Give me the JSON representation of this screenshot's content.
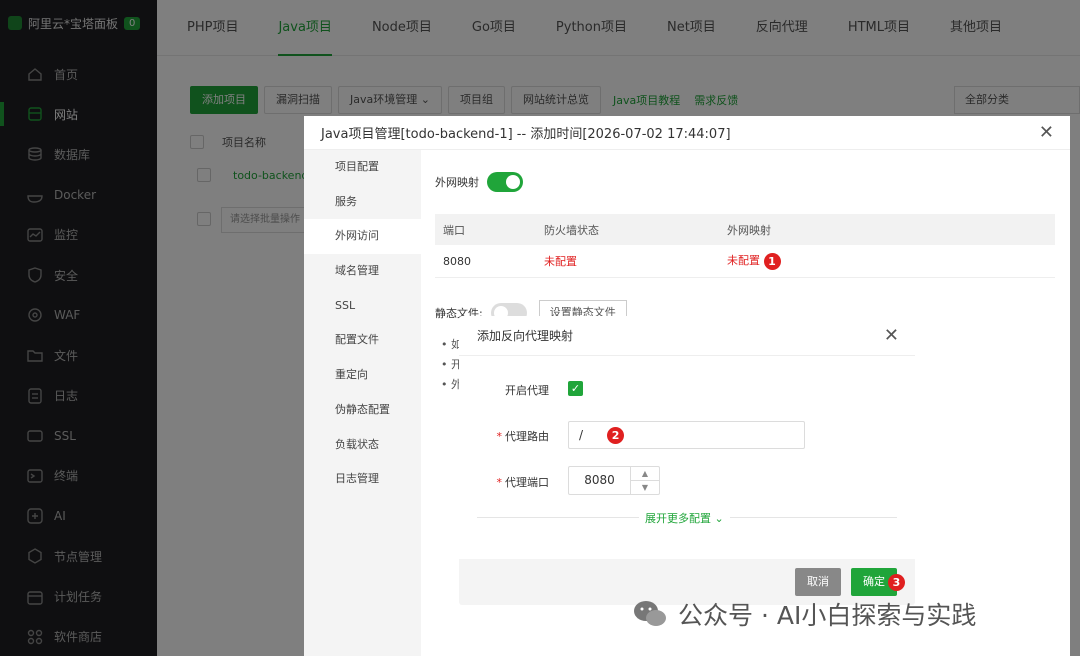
{
  "sidebar": {
    "brand": "阿里云*宝塔面板",
    "badge": "0",
    "items": [
      {
        "label": "首页",
        "icon": "home-icon"
      },
      {
        "label": "网站",
        "icon": "globe-icon",
        "active": true
      },
      {
        "label": "数据库",
        "icon": "database-icon"
      },
      {
        "label": "Docker",
        "icon": "docker-icon"
      },
      {
        "label": "监控",
        "icon": "monitor-icon"
      },
      {
        "label": "安全",
        "icon": "shield-icon"
      },
      {
        "label": "WAF",
        "icon": "waf-icon"
      },
      {
        "label": "文件",
        "icon": "folder-icon"
      },
      {
        "label": "日志",
        "icon": "log-icon"
      },
      {
        "label": "SSL",
        "icon": "ssl-icon"
      },
      {
        "label": "终端",
        "icon": "terminal-icon"
      },
      {
        "label": "AI",
        "icon": "ai-icon"
      },
      {
        "label": "节点管理",
        "icon": "node-icon"
      },
      {
        "label": "计划任务",
        "icon": "calendar-icon"
      },
      {
        "label": "软件商店",
        "icon": "store-icon"
      }
    ]
  },
  "tabs": [
    "PHP项目",
    "Java项目",
    "Node项目",
    "Go项目",
    "Python项目",
    "Net项目",
    "反向代理",
    "HTML项目",
    "其他项目"
  ],
  "toolbar": {
    "add": "添加项目",
    "scan": "漏洞扫描",
    "env": "Java环境管理",
    "group": "项目组",
    "stats": "网站统计总览",
    "tutorial": "Java项目教程",
    "feedback": "需求反馈",
    "category": "全部分类"
  },
  "table": {
    "col_name": "项目名称",
    "row_name": "todo-backend",
    "bulk_placeholder": "请选择批量操作"
  },
  "manage_dialog": {
    "title": "Java项目管理[todo-backend-1] -- 添加时间[2026-07-02 17:44:07]",
    "menu": [
      "项目配置",
      "服务",
      "外网访问",
      "域名管理",
      "SSL",
      "配置文件",
      "重定向",
      "伪静态配置",
      "负载状态",
      "日志管理"
    ],
    "external_mapping_label": "外网映射",
    "external_mapping_on": true,
    "ports_table": {
      "headers": [
        "端口",
        "防火墙状态",
        "外网映射"
      ],
      "rows": [
        [
          "8080",
          "未配置",
          "未配置"
        ]
      ]
    },
    "static_label": "静态文件:",
    "static_button": "设置静态文件",
    "bullets": [
      "如",
      "开",
      "外"
    ]
  },
  "proxy_dialog": {
    "title": "添加反向代理映射",
    "enable_label": "开启代理",
    "enable_checked": true,
    "route_label": "代理路由",
    "route_value": "/",
    "port_label": "代理端口",
    "port_value": "8080",
    "more_label": "展开更多配置",
    "cancel": "取消",
    "confirm": "确定"
  },
  "markers": [
    "1",
    "2",
    "3"
  ],
  "watermark": "公众号 · AI小白探索与实践",
  "colors": {
    "accent": "#20a53a",
    "danger": "#e02020",
    "sidebar": "#1e1f22"
  }
}
